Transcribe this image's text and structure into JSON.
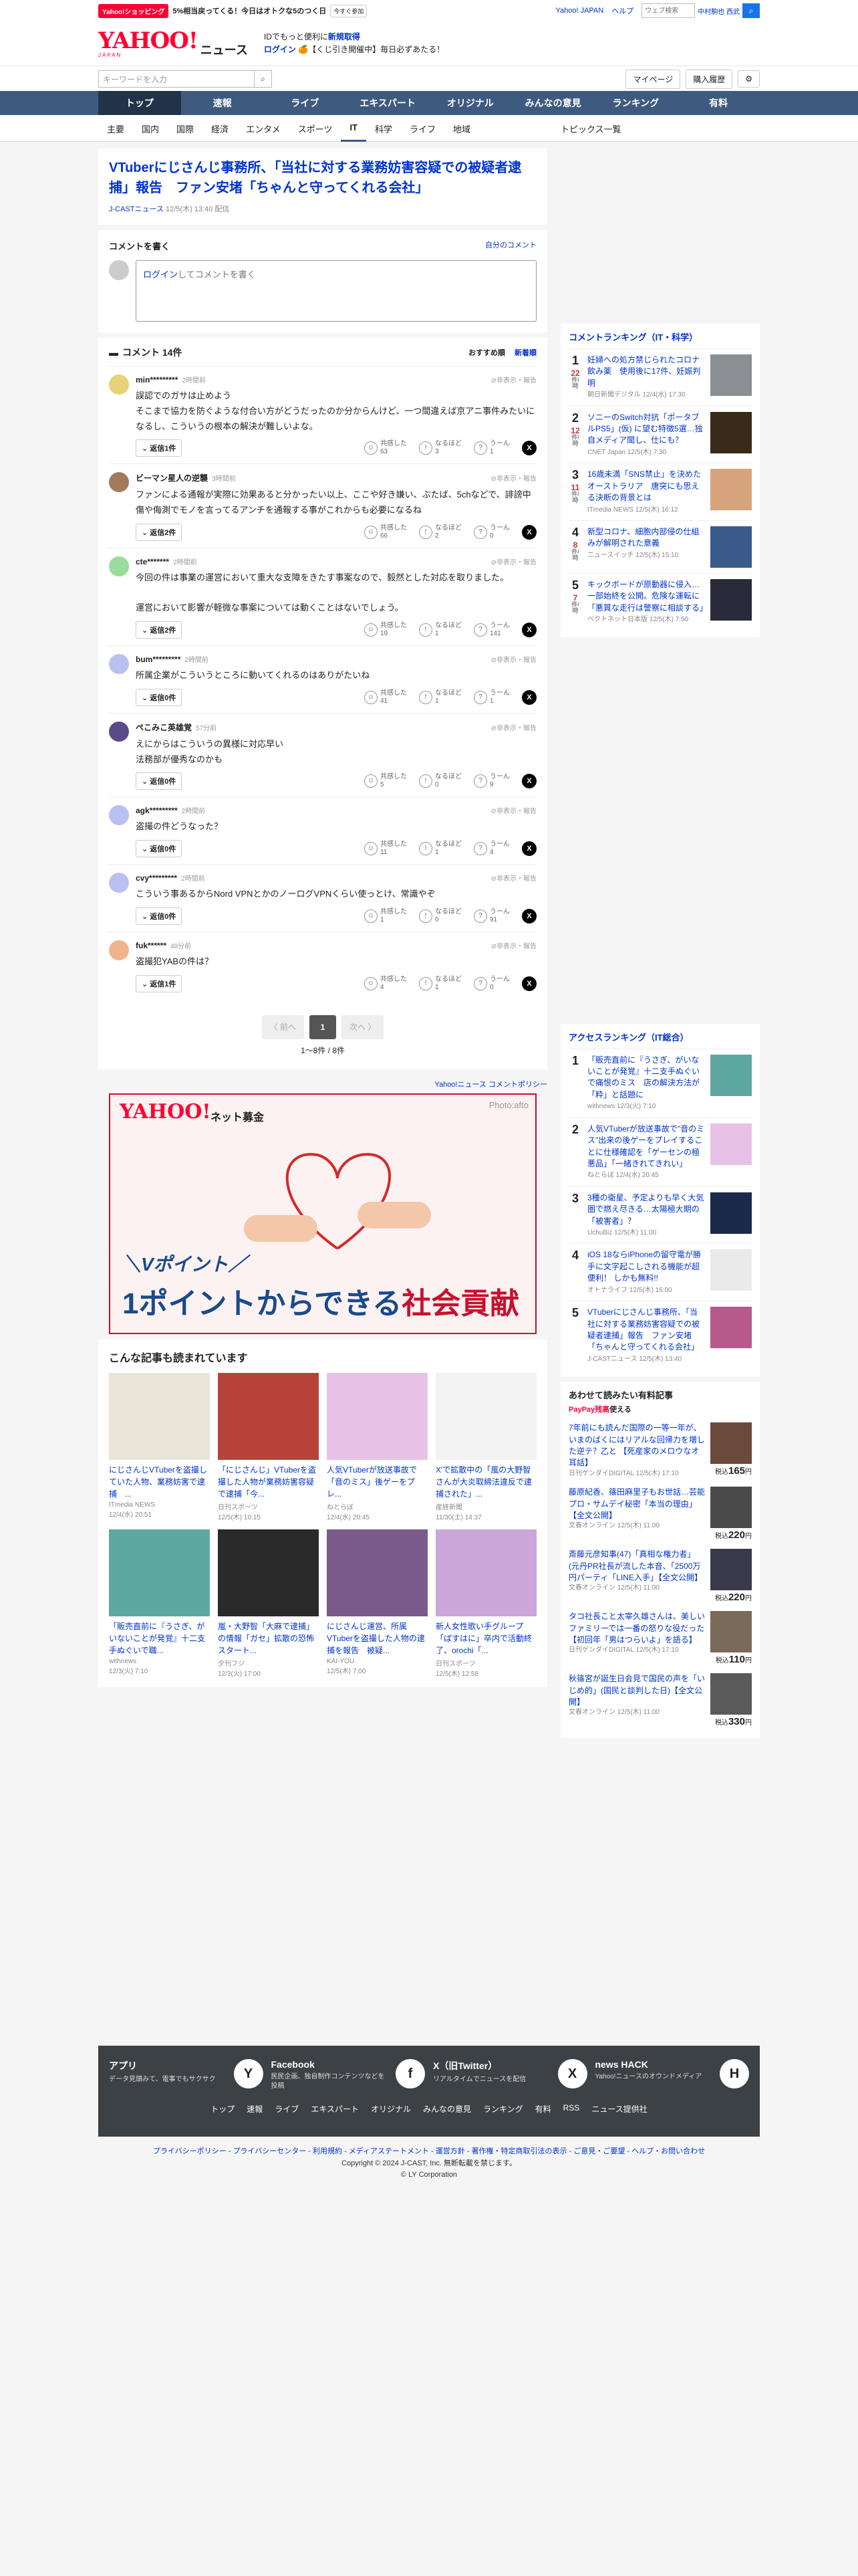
{
  "topbar": {
    "shop": "Yahoo!ショッピング",
    "promo": "5%相当戻ってくる！今日はオトクな5のつく日",
    "promo_btn": "今すぐ参加",
    "links": [
      "Yahoo! JAPAN",
      "ヘルプ"
    ],
    "search_placeholder": "ウェブ検索",
    "weather": "中村駒也 西武"
  },
  "header": {
    "logo": "YAHOO!",
    "logo_sub": "JAPAN",
    "logo_news": "ニュース",
    "msg1_pre": "IDでもっと便利に",
    "msg1_link": "新規取得",
    "msg2_link": "ログイン",
    "msg2_rest": "【くじ引き開催中】毎日必ずあたる！"
  },
  "search": {
    "placeholder": "キーワードを入力",
    "mypage": "マイページ",
    "purchased": "購入履歴"
  },
  "nav": [
    "トップ",
    "速報",
    "ライブ",
    "エキスパート",
    "オリジナル",
    "みんなの意見",
    "ランキング",
    "有料"
  ],
  "subnav": [
    "主要",
    "国内",
    "国際",
    "経済",
    "エンタメ",
    "スポーツ",
    "IT",
    "科学",
    "ライフ",
    "地域"
  ],
  "subnav_right": "トピックス一覧",
  "article": {
    "title": "VTuberにじさんじ事務所、「当社に対する業務妨害容疑での被疑者逮捕」報告　ファン安堵「ちゃんと守ってくれる会社」",
    "source": "J-CASTニュース",
    "date": "12/5(木) 13:40 配信"
  },
  "comment_write": {
    "title": "コメントを書く",
    "own_link": "自分のコメント",
    "login": "ログイン",
    "placeholder_rest": "してコメントを書く"
  },
  "comments": {
    "title": "コメント 14件",
    "sort_recommended": "おすすめ順",
    "sort_new": "新着順",
    "list": [
      {
        "user": "min*********",
        "ago": "2時間前",
        "text": "誤認でのガサは止めよう\nそこまで協力を防ぐような付合い方がどうだったのか分からんけど、一つ間違えば京アニ事件みたいになるし、こういうの根本の解決が難しいよな。",
        "reply": "返信1件",
        "r1": "63",
        "r2": "3",
        "r3": "1",
        "color": "#e7d279"
      },
      {
        "user": "ビーマン星人の逆襲",
        "ago": "3時間前",
        "text": "ファンによる通報が実際に効果あると分かったい以上、ここや好き嫌い、ぶたば、5chなどで、誹謗中傷や侮測でモノを言ってるアンチを通報する事がこれからも必要になるね",
        "reply": "返信2件",
        "r1": "66",
        "r2": "2",
        "r3": "0",
        "color": "#a27a5c"
      },
      {
        "user": "cte*******",
        "ago": "2時間前",
        "text": "今回の件は事業の運営において重大な支障をきたす事案なので、毅然とした対応を取りました。\n\n運営において影響が軽微な事案については動くことはないでしょう。",
        "reply": "返信2件",
        "r1": "19",
        "r2": "1",
        "r3": "141",
        "color": "#9bdb9b"
      },
      {
        "user": "bum*********",
        "ago": "2時間前",
        "text": "所属企業がこういうところに動いてくれるのはありがたいね",
        "reply": "返信0件",
        "r1": "41",
        "r2": "1",
        "r3": "1",
        "color": "#b9c1f0"
      },
      {
        "user": "ぺこみこ英雄覚",
        "ago": "57分前",
        "text": "えにからはこういうの異様に対応早い\n法務部が優秀なのかも",
        "reply": "返信0件",
        "r1": "5",
        "r2": "0",
        "r3": "9",
        "color": "#5b4a8a"
      },
      {
        "user": "agk*********",
        "ago": "2時間前",
        "text": "盗撮の件どうなった？",
        "reply": "返信0件",
        "r1": "11",
        "r2": "1",
        "r3": "4",
        "color": "#b9c1f0"
      },
      {
        "user": "cvy*********",
        "ago": "2時間前",
        "text": "こういう事あるからNord VPNとかのノーログVPNくらい使っとけ、常識やぞ",
        "reply": "返信0件",
        "r1": "1",
        "r2": "0",
        "r3": "91",
        "color": "#b9c1f0"
      },
      {
        "user": "fuk******",
        "ago": "48分前",
        "text": "盗撮犯YABの件は？",
        "reply": "返信1件",
        "r1": "4",
        "r2": "1",
        "r3": "0",
        "color": "#f0b48c"
      }
    ],
    "report": "非表示・報告",
    "react1": "共感した",
    "react2": "なるほど",
    "react3": "うーん"
  },
  "pager": {
    "prev": "〈 前へ",
    "cur": "1",
    "next": "次へ 〉",
    "info": "1〜8件 / 8件"
  },
  "policy": "Yahoo!ニュース コメントポリシー",
  "banner": {
    "logo": "YAHOO!",
    "sub": "ネット募金",
    "credit": "Photo:afto",
    "line1": "＼Vポイント／",
    "line2": "1ポイントからできる",
    "line2_accent": "社会貢献"
  },
  "readmore": {
    "title": "こんな記事も読まれています",
    "items": [
      {
        "title": "にじさんじVTuberを盗撮していた人物、業務妨害で逮捕　...",
        "src": "ITmedia NEWS",
        "date": "12/4(水) 20:51",
        "thumb": "#e9e4d8"
      },
      {
        "title": "「にじさんじ」VTuberを盗撮した人物が業務妨害容疑で逮捕「今...",
        "src": "日刊スポーツ",
        "date": "12/5(木) 10:15",
        "thumb": "#b8423a"
      },
      {
        "title": "人気VTuberが放送事故で「音のミス」後ゲーをプレ...",
        "src": "ねとらぼ",
        "date": "12/4(水) 20:45",
        "thumb": "#e8c2e6"
      },
      {
        "title": "X'で拡散中の「風の大野智さんが大炎取締法違反で逮捕された」...",
        "src": "産経新聞",
        "date": "11/30(土) 14:37",
        "thumb": "#f3f3f3"
      },
      {
        "title": "「販売直前に『うさぎ、がいないことが発覚』十二支手ぬぐいで職...",
        "src": "withnews",
        "date": "12/3(火) 7:10",
        "thumb": "#5fa8a2"
      },
      {
        "title": "嵐・大野智「大麻で逮捕」の情報「ガセ」拡散の恐怖　スタート...",
        "src": "夕刊フジ",
        "date": "12/3(火) 17:00",
        "thumb": "#2a2a2a"
      },
      {
        "title": "にじさんじ運営、所属VTuberを盗撮した人物の逮捕を報告　被疑...",
        "src": "KAI-YOU",
        "date": "12/5(木) 7:00",
        "thumb": "#7a5a8a"
      },
      {
        "title": "新人女性歌い手グループ「ぱすはに」卒内で活動終了、orochi「...",
        "src": "日刊スポーツ",
        "date": "12/5(木) 12:58",
        "thumb": "#caa7d8"
      }
    ]
  },
  "ranking_comment": {
    "title": "コメントランキング（IT・科学）",
    "items": [
      {
        "n": "1",
        "cnt": "22",
        "unit": "件/時",
        "title": "妊婦への処方禁じられたコロナ飲み薬　使用後に17件、妊娠判明",
        "src": "朝日新聞デジタル",
        "date": "12/4(水) 17:30",
        "thumb": "#8b8f93"
      },
      {
        "n": "2",
        "cnt": "12",
        "unit": "件/時",
        "title": "ソニーのSwitch対抗「ポータブルPS5」(仮) に望む特徴5選…独自メディア聞し、仕にも？",
        "src": "CNET Japan",
        "date": "12/5(木) 7:30",
        "thumb": "#3a2a1a"
      },
      {
        "n": "3",
        "cnt": "11",
        "unit": "件/時",
        "title": "16歳未満「SNS禁止」を決めたオーストラリア　唐突にも思える決断の背景とは",
        "src": "ITmedia NEWS",
        "date": "12/5(木) 16:12",
        "thumb": "#d7a37c"
      },
      {
        "n": "4",
        "cnt": "8",
        "unit": "件/時",
        "title": "新型コロナ、細胞内部侵の仕組みが解明された意義",
        "src": "ニュースイッチ",
        "date": "12/5(木) 15:10",
        "thumb": "#3a5a8a"
      },
      {
        "n": "5",
        "cnt": "7",
        "unit": "件/時",
        "title": "キックボードが原動器に侵入…一部始終を公開。危険な運転に「悪質な走行は警察に相談する」",
        "src": "ベクトネット日本版",
        "date": "12/5(木) 7:50",
        "thumb": "#2a2a3a"
      }
    ]
  },
  "ranking_access": {
    "title": "アクセスランキング（IT総合）",
    "items": [
      {
        "n": "1",
        "title": "「販売直前に『うさぎ、がいないことが発覚』十二支手ぬぐいで痛恨のミス　店の解決方法が「粋」と話題に",
        "src": "withnews",
        "date": "12/3(火) 7:10",
        "thumb": "#5fa8a2"
      },
      {
        "n": "2",
        "title": "人気VTuberが放送事故で\"音のミス\"出来の後ゲーをプレイすることに仕様確認を「ゲーセンの極悪品」「一緒きれてきれい」",
        "src": "ねとらぼ",
        "date": "12/4(水) 20:45",
        "thumb": "#e8c2e6"
      },
      {
        "n": "3",
        "title": "3種の衛星、予定よりも早く大気圏で燃え尽きる…太陽極大期の「被害者」？",
        "src": "UchuBiz",
        "date": "12/5(木) 11:00",
        "thumb": "#1a2a4a"
      },
      {
        "n": "4",
        "title": "iOS 18ならiPhoneの留守電が勝手に文字起こしされる機能が超便利！ しかも無料!!",
        "src": "オトナライフ",
        "date": "12/5(木) 16:00",
        "thumb": "#eaeaea"
      },
      {
        "n": "5",
        "title": "VTuberにじさんじ事務所、「当社に対する業務妨害容疑での被疑者逮捕」報告　ファン安堵「ちゃんと守ってくれる会社」",
        "src": "J-CASTニュース",
        "date": "12/5(木) 13:40",
        "thumb": "#b55a8a"
      }
    ]
  },
  "paid": {
    "title": "あわせて読みたい有料記事",
    "paypay": "PayPay残高",
    "paypay_rest": "使える",
    "tax": "税込",
    "items": [
      {
        "title": "7年前にも読んだ国際の一等一年が、いまのばくにはリアルな回帰力を増した逆テ？乙と 【死産家のメロウなオ耳話】",
        "src": "日刊ゲンダイDIGITAL",
        "date": "12/5(木) 17:10",
        "price": "165",
        "unit": "円",
        "thumb": "#6b4a3a"
      },
      {
        "title": "藤原紀香、篠田麻里子もお世話…芸能プロ・サムデイ秘密「本当の理由」【全文公開】",
        "src": "文春オンライン",
        "date": "12/5(木) 11:00",
        "price": "220",
        "unit": "円",
        "thumb": "#4a4a4a"
      },
      {
        "title": "斎藤元彦知事(47)「真相な権力者」(元丹PR社長が流した本音、「2500万円パーティ「LINE入手」【全文公開】",
        "src": "文春オンライン",
        "date": "12/5(木) 11:00",
        "price": "220",
        "unit": "円",
        "thumb": "#3a3a4a"
      },
      {
        "title": "タコ社長こと太宰久雄さんは、美しいファミリーでは一番の怒りな役だった【初回年「男はつらいよ」を語る】",
        "src": "日刊ゲンダイDIGITAL",
        "date": "12/5(木) 17:10",
        "price": "110",
        "unit": "円",
        "thumb": "#7a6a5a"
      },
      {
        "title": "秋篠宮が誕生日会見で国民の声を「いじめ的」(国民と談判した日)【全文公開】",
        "src": "文春オンライン",
        "date": "12/5(木) 11:00",
        "price": "330",
        "unit": "円",
        "thumb": "#5a5a5a"
      }
    ]
  },
  "footer": {
    "apps": [
      {
        "t": "アプリ",
        "d": "データ見頭みて、電事でもサクサク",
        "icon": "Y"
      },
      {
        "t": "Facebook",
        "d": "民民企画、独自制作コンテンツなどを投稿",
        "icon": "f"
      },
      {
        "t": "X（旧Twitter）",
        "d": "リアルタイムでニュースを配信",
        "icon": "X"
      },
      {
        "t": "news HACK",
        "d": "Yahoo!ニュースのオウンドメディア",
        "icon": "H"
      }
    ],
    "nav": [
      "トップ",
      "速報",
      "ライブ",
      "エキスパート",
      "オリジナル",
      "みんなの意見",
      "ランキング",
      "有料",
      "RSS",
      "ニュース提供社"
    ],
    "links": "プライバシーポリシー - プライバシーセンター - 利用規約 - メディアステートメント - 運営方針 - 著作権・特定商取引法の表示 - ご意見・ご要望 - ヘルプ・お問い合わせ",
    "copy1": "Copyright © 2024 J-CAST, Inc. 無断転載を禁じます。",
    "copy2": "© LY Corporation"
  }
}
